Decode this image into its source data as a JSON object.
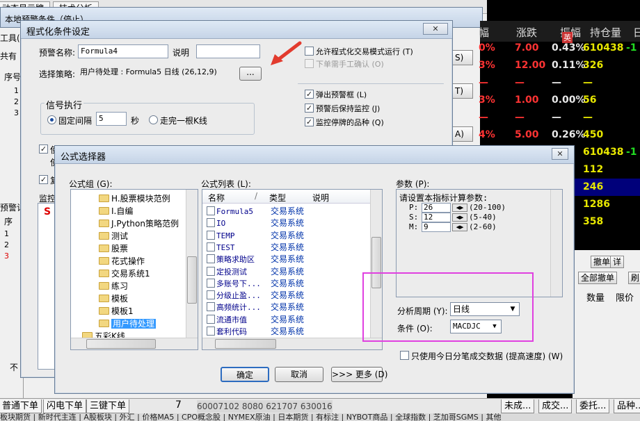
{
  "background": {
    "tabs": [
      "动态显示牌",
      "技术分析"
    ],
    "back_window_title": "本地预警条件（停止）",
    "left_labels": [
      "工具(",
      "共有",
      "序号",
      "1",
      "2",
      "3",
      "预警记",
      "序",
      "1",
      "2",
      "3",
      "不"
    ],
    "market": {
      "headers": [
        "幅",
        "涨跌",
        "振幅",
        "持仓量",
        "日"
      ],
      "rows": [
        {
          "pct": "0%",
          "change": "7.00",
          "amp": "0.43%",
          "oi": "610438",
          "extra": "-1"
        },
        {
          "pct": "3%",
          "change": "12.00",
          "amp": "0.11%",
          "oi": "326",
          "extra": ""
        },
        {
          "pct": "—",
          "change": "—",
          "amp": "—",
          "oi": "—",
          "extra": ""
        },
        {
          "pct": "3%",
          "change": "1.00",
          "amp": "0.00%",
          "oi": "56",
          "extra": ""
        },
        {
          "pct": "—",
          "change": "—",
          "amp": "—",
          "oi": "—",
          "extra": ""
        },
        {
          "pct": "4%",
          "change": "5.00",
          "amp": "0.26%",
          "oi": "450",
          "extra": ""
        },
        {
          "pct": "",
          "change": "",
          "amp": "",
          "oi": "610438",
          "extra": "-1"
        },
        {
          "pct": "",
          "change": "",
          "amp": "",
          "oi": "112",
          "extra": ""
        },
        {
          "pct": "",
          "change": "",
          "amp": "",
          "oi": "246",
          "extra": ""
        },
        {
          "pct": "",
          "change": "",
          "amp": "",
          "oi": "1286",
          "extra": ""
        },
        {
          "pct": "",
          "change": "",
          "amp": "",
          "oi": "358",
          "extra": ""
        }
      ],
      "ime_label": "英"
    },
    "right_buttons": [
      "撤单",
      "详",
      "全部撤单",
      "刷"
    ],
    "right_headers": [
      "数量",
      "限价"
    ],
    "side_buttons": [
      "S)",
      "T)",
      "A)"
    ],
    "bottom_tabs": [
      "普通下单",
      "闪电下单",
      "三键下单"
    ],
    "bottom_num": "7",
    "bottom_codes": "60007102  8080  621707  630016",
    "bottom_right_tabs": [
      "未成...",
      "成交...",
      "委托...",
      "品种..."
    ],
    "strip_text": "  板块期货  |  新时代主连  |  A股板块  |  外汇  |  价格MA5  |  CPO概念股  |  NYMEX原油  |  日本期货  |  有标注  |  NYBOT商品  |  全球指数  |  芝加哥SGMS  |  其他"
  },
  "cond_window": {
    "title": "程式化条件设定",
    "alert_name_label": "预警名称:",
    "alert_name_value": "Formula4",
    "desc_label": "说明",
    "desc_value": "",
    "strategy_label": "选择策略:",
    "strategy_value": "用户待处理 : Formula5 日线 (26,12,9)",
    "browse_label": "...",
    "allow_program_trade": "允许程式化交易模式运行 (T)",
    "manual_confirm": "下单需手工确认 (O)",
    "signal_group": "信号执行",
    "fixed_interval_label": "固定间隔",
    "fixed_interval_value": "5",
    "seconds_label": "秒",
    "kline_label": "走完一根K线",
    "popup_alert": "弹出预警框 (L)",
    "keep_monitor": "预警后保持监控 (J)",
    "monitor_suspended": "监控停牌的品种 (Q)",
    "partial_left": [
      "使",
      "使",
      "复",
      "监控"
    ],
    "partial_s": "S"
  },
  "formula_window": {
    "title": "公式选择器",
    "group_label": "公式组 (G):",
    "groups": [
      "H.股票模块范例",
      "I.自编",
      "J.Python策略范例",
      "测试",
      "股票",
      "花式操作",
      "交易系统1",
      "练习",
      "模板",
      "模板1",
      "用户待处理",
      "五彩K线"
    ],
    "selected_group": "用户待处理",
    "list_label": "公式列表 (L):",
    "col_name": "名称",
    "col_type": "类型",
    "col_desc": "说明",
    "formulas": [
      {
        "name": "Formula5",
        "type": "交易系统"
      },
      {
        "name": "IO",
        "type": "交易系统"
      },
      {
        "name": "TEMP",
        "type": "交易系统"
      },
      {
        "name": "TEST",
        "type": "交易系统"
      },
      {
        "name": "策略求助区",
        "type": "交易系统"
      },
      {
        "name": "定投测试",
        "type": "交易系统"
      },
      {
        "name": "多账号下...",
        "type": "交易系统"
      },
      {
        "name": "分级止盈...",
        "type": "交易系统"
      },
      {
        "name": "高频统计...",
        "type": "交易系统"
      },
      {
        "name": "流通市值",
        "type": "交易系统"
      },
      {
        "name": "套利代码",
        "type": "交易系统"
      }
    ],
    "params_label": "参数 (P):",
    "params_title": "请设置本指标计算参数:",
    "params": [
      {
        "name": "P:",
        "value": "26",
        "range": "(20-100)"
      },
      {
        "name": "S:",
        "value": "12",
        "range": "(5-40)"
      },
      {
        "name": "M:",
        "value": "9",
        "range": "(2-60)"
      }
    ],
    "period_label": "分析周期 (Y):",
    "period_value": "日线",
    "condition_label": "条件 (O):",
    "condition_value": "MACDJC",
    "only_today_label": "只使用今日分笔成交数据 (提高速度) (W)",
    "ok_label": "确定",
    "cancel_label": "取消",
    "more_label": ">>> 更多 (D)",
    "highlight_color": "#e040e0"
  }
}
